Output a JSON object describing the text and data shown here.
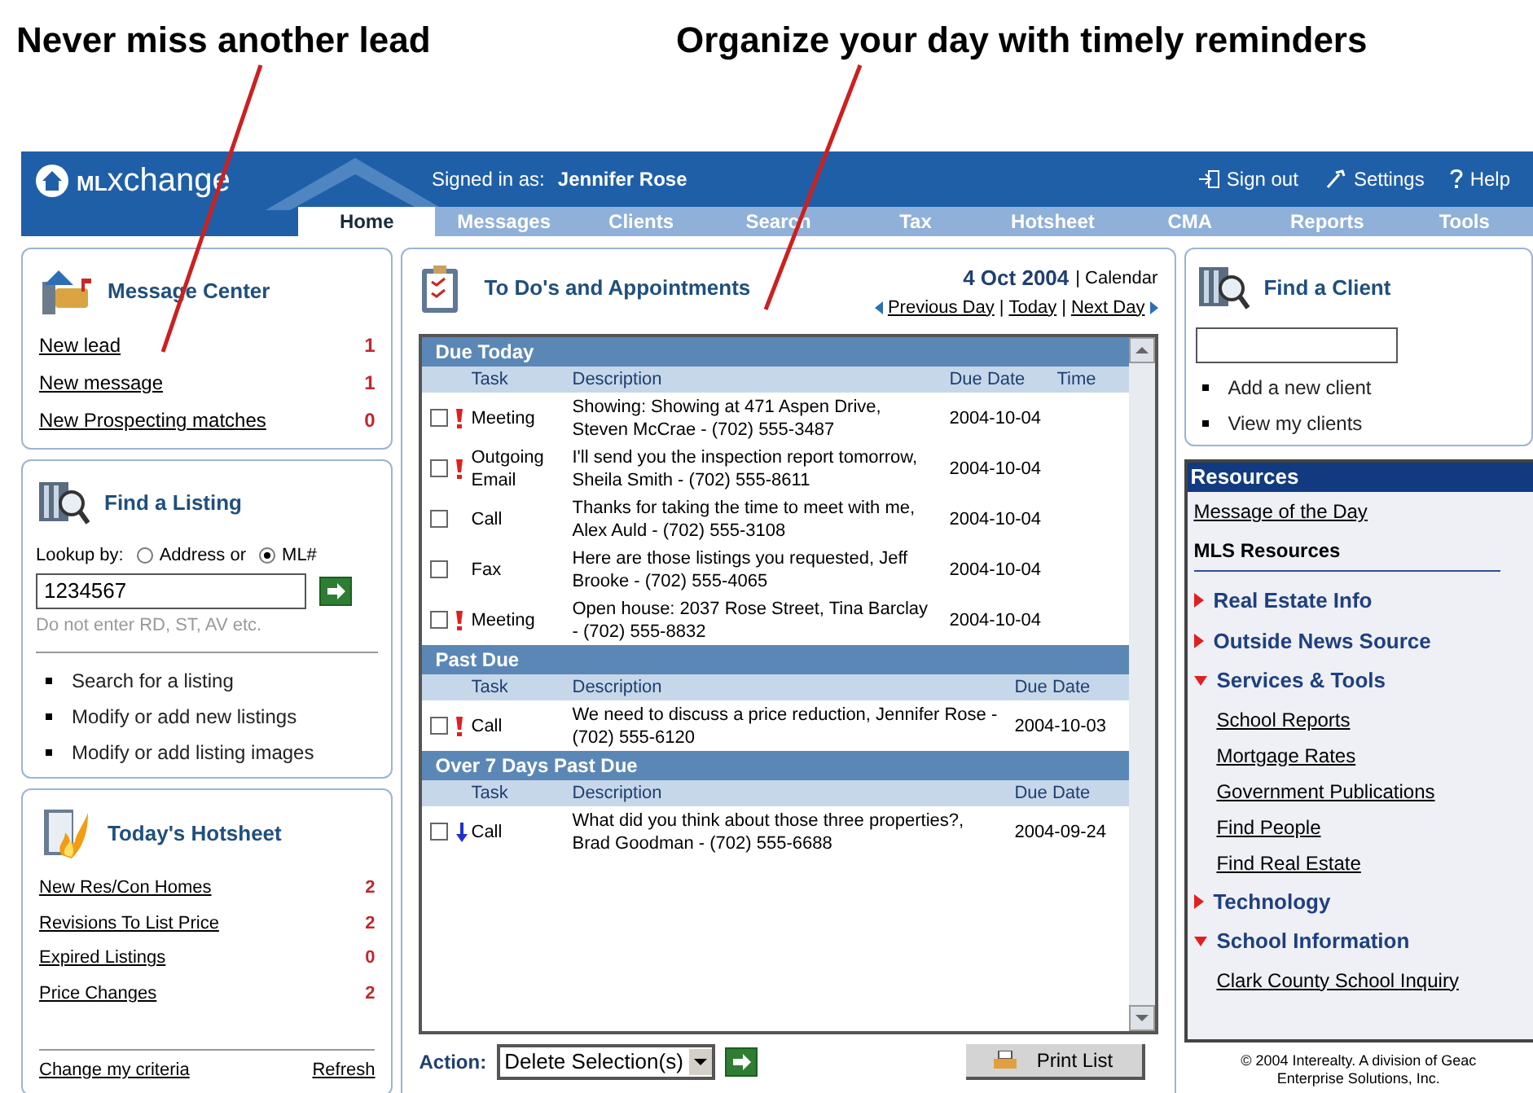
{
  "callouts": [
    {
      "text": "Never miss another lead"
    },
    {
      "text": "Organize your day with timely reminders"
    }
  ],
  "header": {
    "logo_prefix": "ML",
    "logo_suffix": "xchange",
    "signed_in_label": "Signed in as:",
    "user": "Jennifer Rose",
    "links": [
      {
        "kind": "signout",
        "label": "Sign out"
      },
      {
        "kind": "settings",
        "label": "Settings"
      },
      {
        "kind": "help",
        "label": "Help"
      }
    ]
  },
  "nav": [
    {
      "label": "Home",
      "selected": true
    },
    {
      "label": "Messages",
      "selected": false
    },
    {
      "label": "Clients",
      "selected": false
    },
    {
      "label": "Search",
      "selected": false
    },
    {
      "label": "Tax",
      "selected": false
    },
    {
      "label": "Hotsheet",
      "selected": false
    },
    {
      "label": "CMA",
      "selected": false
    },
    {
      "label": "Reports",
      "selected": false
    },
    {
      "label": "Tools",
      "selected": false
    }
  ],
  "message_center": {
    "title": "Message Center",
    "items": [
      {
        "label": "New lead",
        "count": "1"
      },
      {
        "label": "New message",
        "count": "1"
      },
      {
        "label": "New Prospecting matches",
        "count": "0"
      }
    ]
  },
  "find_listing": {
    "title": "Find a Listing",
    "lookup_label": "Lookup by:",
    "options": [
      {
        "label": "Address or",
        "selected": false
      },
      {
        "label": "ML#",
        "selected": true
      }
    ],
    "value": "1234567",
    "hint": "Do not enter RD, ST, AV etc.",
    "links": [
      "Search for a listing",
      "Modify or add new listings",
      "Modify or add listing images"
    ]
  },
  "hotsheet": {
    "title": "Today's Hotsheet",
    "items": [
      {
        "label": "New Res/Con Homes",
        "count": "2"
      },
      {
        "label": "Revisions To List Price",
        "count": "2"
      },
      {
        "label": "Expired Listings",
        "count": "0"
      },
      {
        "label": "Price Changes",
        "count": "2"
      }
    ],
    "footer_links": [
      "Change my criteria",
      "Refresh"
    ]
  },
  "todo": {
    "title": "To Do's and Appointments",
    "date": "4 Oct 2004",
    "calendar_link": "| Calendar",
    "nav_links": [
      "Previous Day",
      "Today",
      "Next Day"
    ],
    "nav_separators": [
      "|",
      "|"
    ],
    "sections": [
      {
        "title": "Due Today",
        "columns": [
          "Task",
          "Description",
          "Due Date",
          "Time"
        ],
        "rows": [
          {
            "checked": false,
            "urgent": true,
            "low": false,
            "task": "Meeting",
            "description": "Showing: Showing at 471 Aspen Drive, Steven McCrae - (702) 555-3487",
            "due_date": "2004-10-04"
          },
          {
            "checked": false,
            "urgent": true,
            "low": false,
            "task": "Outgoing Email",
            "description": "I'll send you the inspection report tomorrow, Sheila Smith - (702) 555-8611",
            "due_date": "2004-10-04"
          },
          {
            "checked": false,
            "urgent": false,
            "low": false,
            "task": "Call",
            "description": "Thanks for taking the time to meet with me, Alex Auld - (702) 555-3108",
            "due_date": "2004-10-04"
          },
          {
            "checked": false,
            "urgent": false,
            "low": false,
            "task": "Fax",
            "description": "Here are those listings you requested, Jeff Brooke - (702) 555-4065",
            "due_date": "2004-10-04"
          },
          {
            "checked": false,
            "urgent": true,
            "low": false,
            "task": "Meeting",
            "description": "Open house: 2037 Rose Street, Tina Barclay - (702) 555-8832",
            "due_date": "2004-10-04"
          }
        ]
      },
      {
        "title": "Past Due",
        "columns": [
          "Task",
          "Description",
          "Due Date"
        ],
        "rows": [
          {
            "checked": false,
            "urgent": true,
            "low": false,
            "task": "Call",
            "description": "We need to discuss a price reduction, Jennifer Rose - (702) 555-6120",
            "due_date": "2004-10-03"
          }
        ]
      },
      {
        "title": "Over 7 Days Past Due",
        "columns": [
          "Task",
          "Description",
          "Due Date"
        ],
        "rows": [
          {
            "checked": false,
            "urgent": false,
            "low": true,
            "task": "Call",
            "description": "What did you think about those three properties?, Brad Goodman - (702) 555-6688",
            "due_date": "2004-09-24"
          }
        ]
      }
    ],
    "action_label": "Action:",
    "action_value": "Delete Selection(s)",
    "print_button": "Print List"
  },
  "find_client": {
    "title": "Find a Client",
    "links": [
      "Add a new client",
      "View my clients"
    ]
  },
  "resources": {
    "title": "Resources",
    "message_link": "Message of the Day",
    "subtitle": "MLS Resources",
    "groups": [
      {
        "label": "Real Estate Info",
        "expanded": false
      },
      {
        "label": "Outside News Source",
        "expanded": false
      },
      {
        "label": "Services & Tools",
        "expanded": true,
        "children": [
          "School Reports",
          "Mortgage Rates",
          "Government Publications",
          "Find People",
          "Find Real Estate"
        ]
      },
      {
        "label": "Technology",
        "expanded": false
      },
      {
        "label": "School Information",
        "expanded": true,
        "children": [
          "Clark County School Inquiry"
        ]
      }
    ]
  },
  "footer": [
    "© 2004 Interealty. A division of Geac",
    "Enterprise Solutions, Inc."
  ]
}
